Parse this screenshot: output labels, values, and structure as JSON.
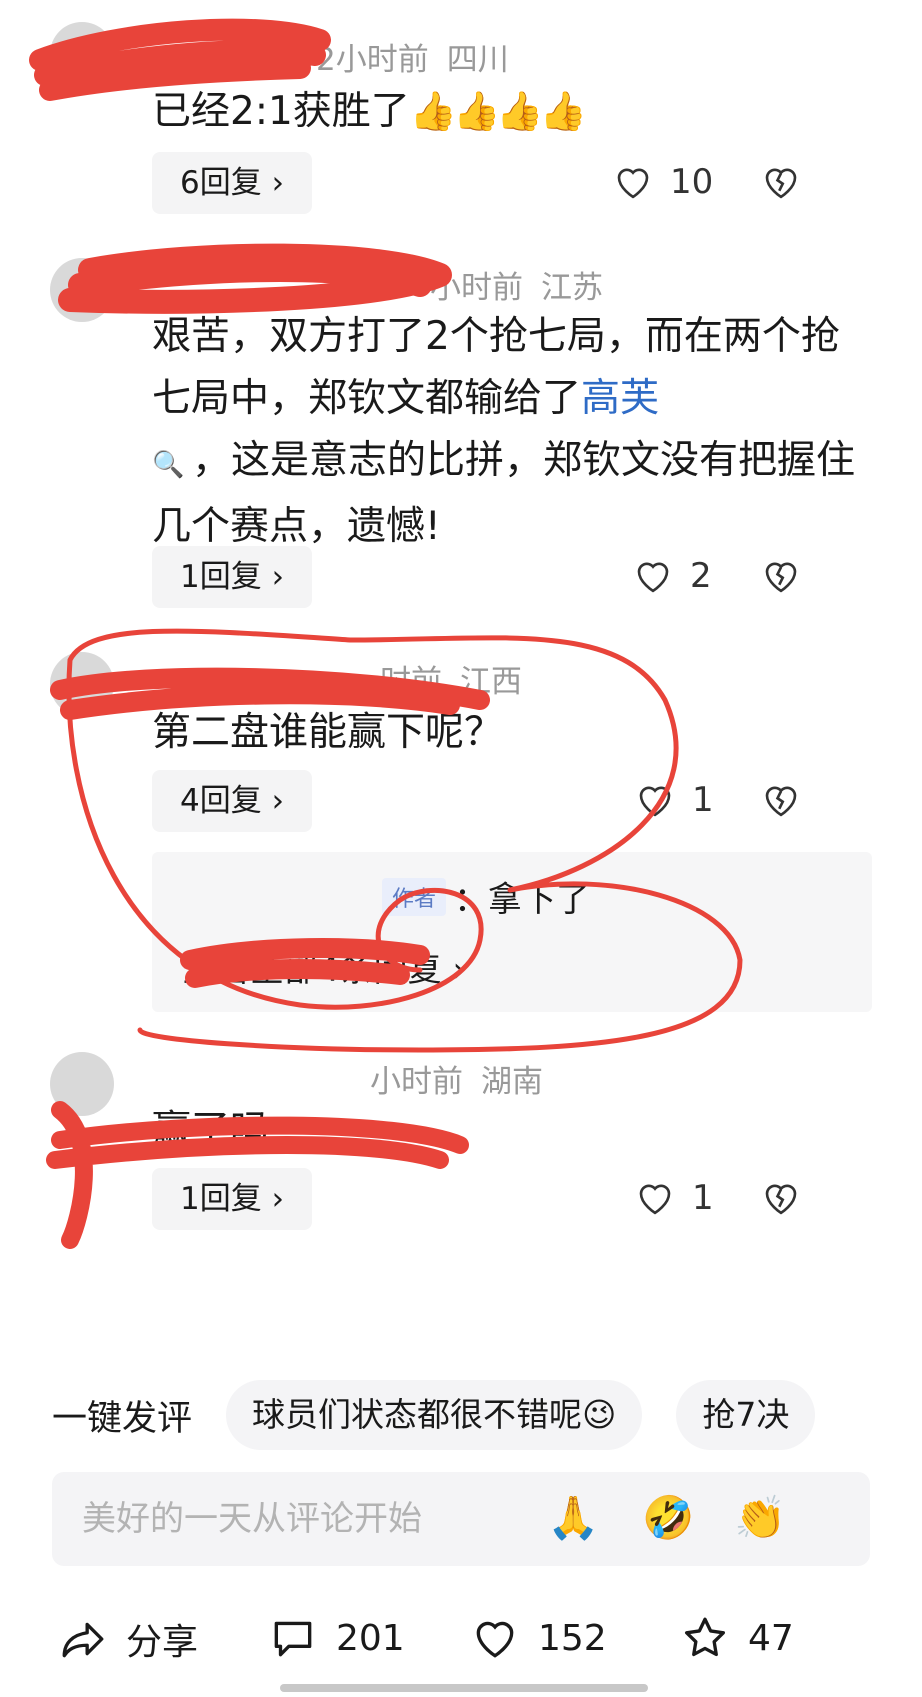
{
  "comments": [
    {
      "time": "2小时前",
      "location": "四川",
      "text": "已经2:1获胜了",
      "emojis": "👍👍👍👍",
      "replies": "6回复 ›",
      "likes": "10"
    },
    {
      "time": "小时前",
      "location": "江苏",
      "text_before_link": "艰苦，双方打了2个抢七局，而在两个抢七局中，郑钦文都输给了",
      "link": "高芙",
      "text_after_link": "，这是意志的比拼，郑钦文没有把握住几个赛点，遗憾!",
      "replies": "1回复 ›",
      "likes": "2"
    },
    {
      "time": "时前",
      "location": "江西",
      "text": "第二盘谁能赢下呢？",
      "replies": "4回复 ›",
      "likes": "1",
      "sub_reply": {
        "author_tag": "作者",
        "text": "：拿下了",
        "view_all": "查看全部4条回复 ›"
      }
    },
    {
      "time": "小时前",
      "location": "湖南",
      "text": "赢了吗",
      "replies": "1回复 ›",
      "likes": "1"
    }
  ],
  "quick_comment": {
    "label": "一键发评",
    "chips": [
      "球员们状态都很不错呢😉",
      "抢7决"
    ]
  },
  "input": {
    "placeholder": "美好的一天从评论开始",
    "emojis": [
      "🙏",
      "🤣",
      "👏"
    ]
  },
  "bottom_bar": {
    "share": "分享",
    "comments": "201",
    "likes": "152",
    "favorites": "47"
  },
  "colors": {
    "scribble": "#e8443a",
    "link": "#2e6bc6",
    "meta": "#999999",
    "chip_bg": "#f4f4f6"
  }
}
